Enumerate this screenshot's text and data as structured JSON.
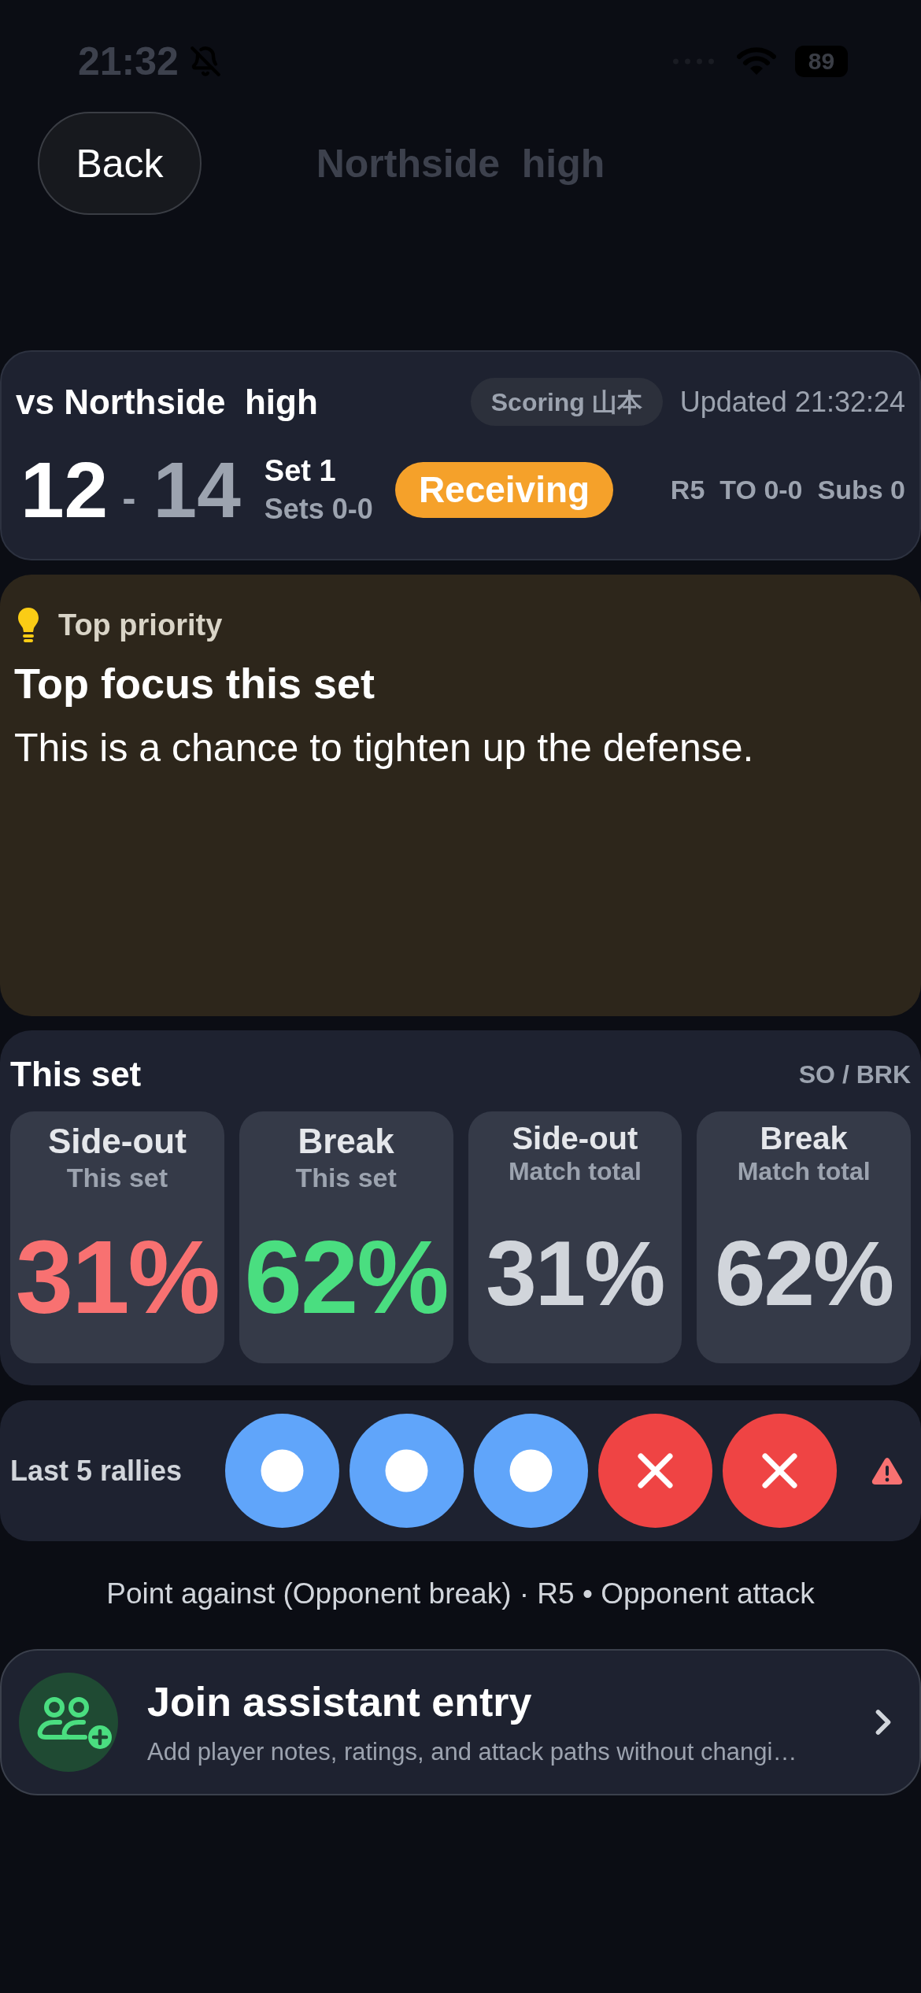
{
  "status_bar": {
    "time": "21:32",
    "battery": "89"
  },
  "nav": {
    "back": "Back",
    "title": "Northside  high"
  },
  "match": {
    "opponent": "vs Northside  high",
    "scorer": "Scoring 山本",
    "updated": "Updated 21:32:24",
    "home_score": "12",
    "separator": "-",
    "away_score": "14",
    "set": "Set 1",
    "sets": "Sets 0-0",
    "phase": "Receiving",
    "details": [
      "R5",
      "TO 0-0",
      "Subs 0"
    ]
  },
  "priority": {
    "label": "Top priority",
    "title": "Top focus this set",
    "body": "This is a chance to tighten up the defense."
  },
  "stats": {
    "title": "This set",
    "legend": "SO / BRK",
    "tiles": [
      {
        "kind": "current",
        "title": "Side-out",
        "subtitle": "This set",
        "value": "31%",
        "color": "#f87171"
      },
      {
        "kind": "current",
        "title": "Break",
        "subtitle": "This set",
        "value": "62%",
        "color": "#4ade80"
      },
      {
        "kind": "total",
        "title": "Side-out",
        "subtitle": "Match total",
        "value": "31%",
        "color": "#d1d5db"
      },
      {
        "kind": "total",
        "title": "Break",
        "subtitle": "Match total",
        "value": "62%",
        "color": "#d1d5db"
      }
    ]
  },
  "rallies": {
    "label": "Last 5 rallies",
    "items": [
      {
        "won": true
      },
      {
        "won": true
      },
      {
        "won": true
      },
      {
        "won": false
      },
      {
        "won": false
      }
    ]
  },
  "last_event": "Point against (Opponent break) · R5 • Opponent attack",
  "assistant": {
    "title": "Join assistant entry",
    "subtitle": "Add player notes, ratings, and attack paths without changi…"
  }
}
